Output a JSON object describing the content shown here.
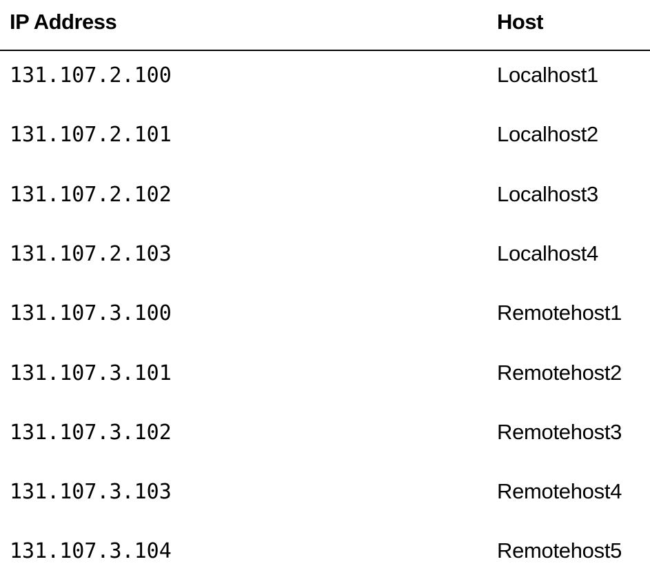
{
  "table": {
    "headers": {
      "ip": "IP Address",
      "host": "Host"
    },
    "rows": [
      {
        "ip": "131.107.2.100",
        "host": "Localhost1"
      },
      {
        "ip": "131.107.2.101",
        "host": "Localhost2"
      },
      {
        "ip": "131.107.2.102",
        "host": "Localhost3"
      },
      {
        "ip": "131.107.2.103",
        "host": "Localhost4"
      },
      {
        "ip": "131.107.3.100",
        "host": "Remotehost1"
      },
      {
        "ip": "131.107.3.101",
        "host": "Remotehost2"
      },
      {
        "ip": "131.107.3.102",
        "host": "Remotehost3"
      },
      {
        "ip": "131.107.3.103",
        "host": "Remotehost4"
      },
      {
        "ip": "131.107.3.104",
        "host": "Remotehost5"
      }
    ]
  }
}
